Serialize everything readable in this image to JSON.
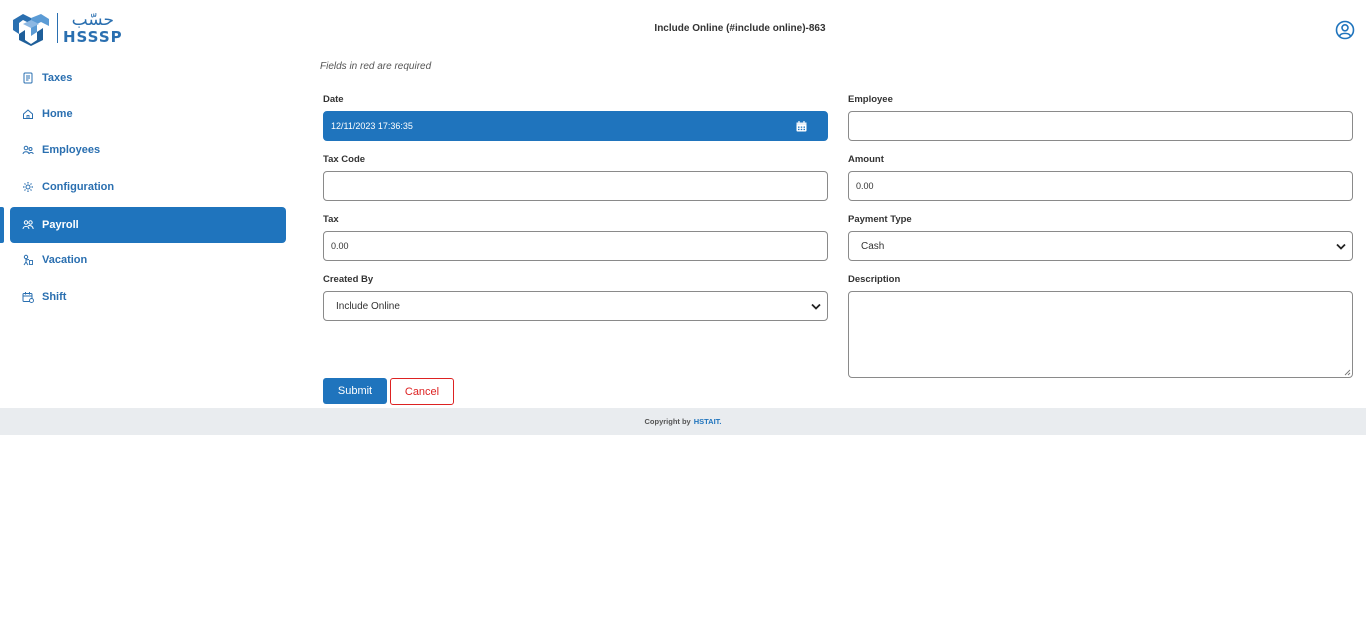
{
  "header": {
    "logo_arabic": "حسّب",
    "logo_latin": "HSSSP",
    "title": "Include Online (#include online)-863",
    "brand_color": "#1f74bd"
  },
  "sidebar": {
    "items": [
      {
        "label": "Taxes",
        "icon": "document-icon",
        "active": false
      },
      {
        "label": "Home",
        "icon": "home-icon",
        "active": false
      },
      {
        "label": "Employees",
        "icon": "users-icon",
        "active": false
      },
      {
        "label": "Configuration",
        "icon": "gear-icon",
        "active": false
      },
      {
        "label": "Payroll",
        "icon": "payroll-icon",
        "active": true
      },
      {
        "label": "Vacation",
        "icon": "vacation-icon",
        "active": false
      },
      {
        "label": "Shift",
        "icon": "shift-icon",
        "active": false
      }
    ]
  },
  "form": {
    "required_note": "Fields in red are required",
    "date": {
      "label": "Date",
      "value": "12/11/2023 17:36:35"
    },
    "employee": {
      "label": "Employee",
      "value": ""
    },
    "tax_code": {
      "label": "Tax Code",
      "value": ""
    },
    "amount": {
      "label": "Amount",
      "value": "0.00"
    },
    "tax": {
      "label": "Tax",
      "value": "0.00"
    },
    "payment_type": {
      "label": "Payment Type",
      "value": "Cash"
    },
    "created_by": {
      "label": "Created By",
      "value": "Include Online"
    },
    "description": {
      "label": "Description",
      "value": ""
    },
    "submit_label": "Submit",
    "cancel_label": "Cancel"
  },
  "footer": {
    "copyright_text": "Copyright by",
    "brand": "HSTAIT."
  }
}
